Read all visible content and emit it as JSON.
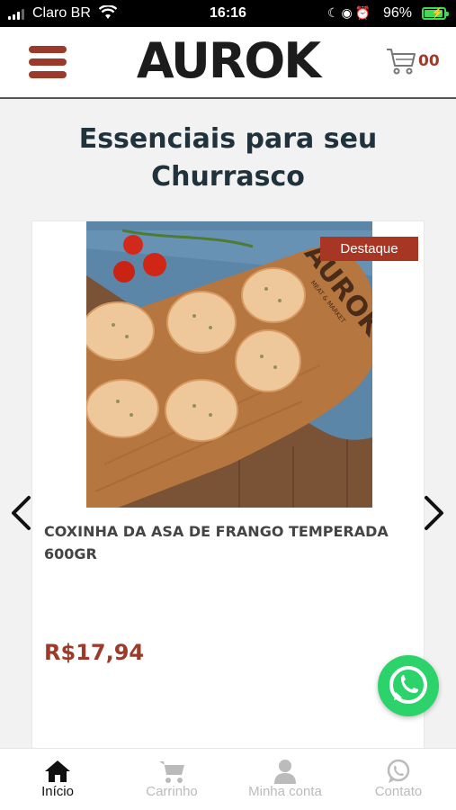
{
  "status_bar": {
    "carrier": "Claro BR",
    "time": "16:16",
    "battery_percent": "96%",
    "battery_level": 0.96
  },
  "header": {
    "brand": "AUROK",
    "cart_count": "00",
    "accent_color": "#9b3a2a"
  },
  "section": {
    "title": "Essenciais para seu Churrasco"
  },
  "product": {
    "badge": "Destaque",
    "name": "COXINHA DA ASA DE FRANGO TEMPERADA 600GR",
    "price": "R$17,94",
    "image_board_brand": "AUROK",
    "image_board_sub": "MEAT & MARKET"
  },
  "bottom_nav": {
    "items": [
      {
        "label": "Início",
        "icon": "home-icon",
        "active": true
      },
      {
        "label": "Carrinho",
        "icon": "cart-icon",
        "active": false
      },
      {
        "label": "Minha conta",
        "icon": "user-icon",
        "active": false
      },
      {
        "label": "Contato",
        "icon": "whatsapp-icon",
        "active": false
      }
    ]
  }
}
